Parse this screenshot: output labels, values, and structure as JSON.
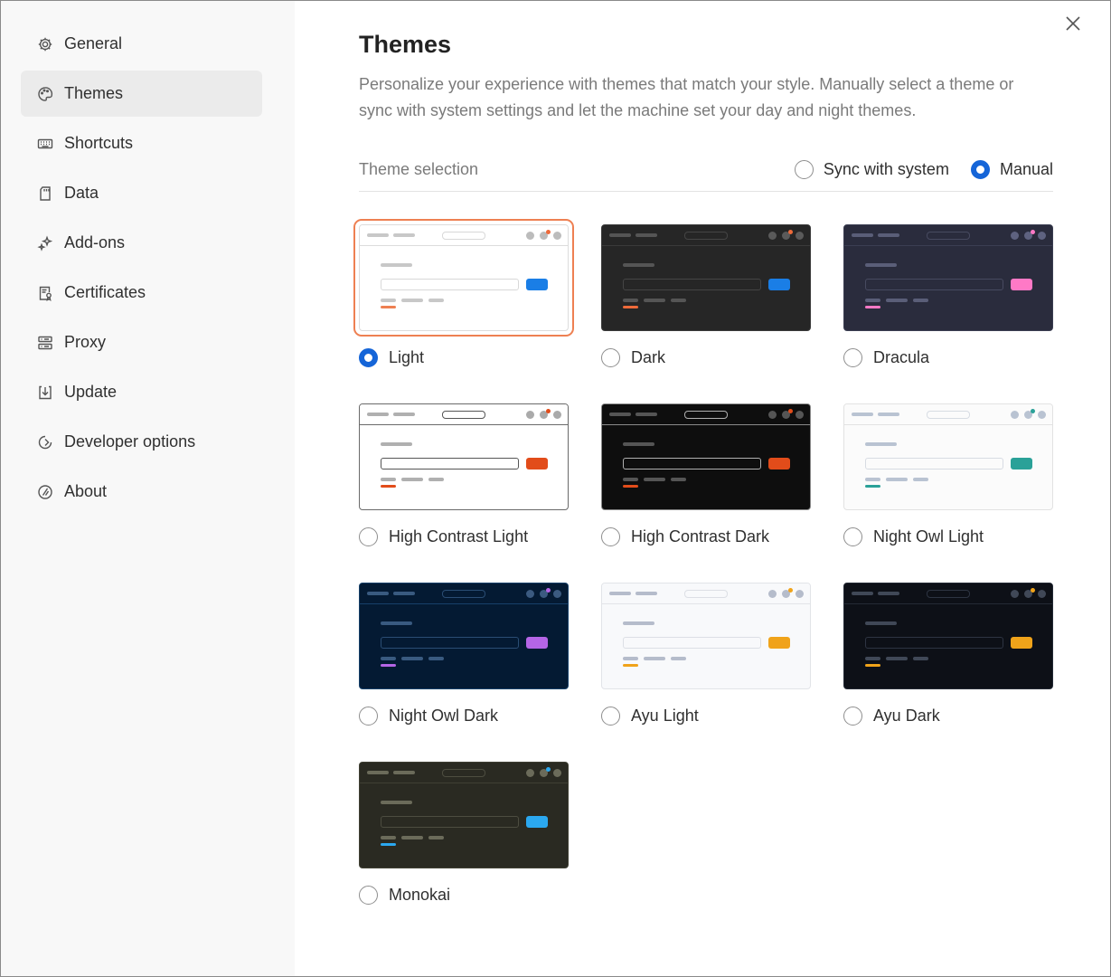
{
  "sidebar": {
    "items": [
      {
        "label": "General",
        "icon": "gear-icon",
        "active": false
      },
      {
        "label": "Themes",
        "icon": "palette-icon",
        "active": true
      },
      {
        "label": "Shortcuts",
        "icon": "keyboard-icon",
        "active": false
      },
      {
        "label": "Data",
        "icon": "sd-card-icon",
        "active": false
      },
      {
        "label": "Add-ons",
        "icon": "sparkles-icon",
        "active": false
      },
      {
        "label": "Certificates",
        "icon": "certificate-icon",
        "active": false
      },
      {
        "label": "Proxy",
        "icon": "server-icon",
        "active": false
      },
      {
        "label": "Update",
        "icon": "download-icon",
        "active": false
      },
      {
        "label": "Developer options",
        "icon": "developer-icon",
        "active": false
      },
      {
        "label": "About",
        "icon": "info-badge-icon",
        "active": false
      }
    ]
  },
  "header": {
    "title": "Themes",
    "description": "Personalize your experience with themes that match your style. Manually select a theme or sync with system settings and let the machine set your day and night themes."
  },
  "theme_selection": {
    "label": "Theme selection",
    "options": [
      {
        "label": "Sync with system",
        "checked": false
      },
      {
        "label": "Manual",
        "checked": true
      }
    ]
  },
  "themes": [
    {
      "label": "Light",
      "checked": true,
      "colors": {
        "bg": "#ffffff",
        "bar": "#ffffff",
        "border": "#dcdcdc",
        "line": "#c8c8c8",
        "inputBorder": "#d8d8d8",
        "btn": "#1a7ee6",
        "underline": "#ee8052",
        "dot": "#bcbcbc",
        "accent": "#ee6a3a"
      }
    },
    {
      "label": "Dark",
      "checked": false,
      "colors": {
        "bg": "#262626",
        "bar": "#262626",
        "border": "#3a3a3a",
        "line": "#555555",
        "inputBorder": "#454545",
        "btn": "#1a7ee6",
        "underline": "#ee6a3a",
        "dot": "#5a5a5a",
        "accent": "#ee6a3a"
      }
    },
    {
      "label": "Dracula",
      "checked": false,
      "colors": {
        "bg": "#2a2c3d",
        "bar": "#2a2c3d",
        "border": "#3b3e52",
        "line": "#5a5e78",
        "inputBorder": "#474a60",
        "btn": "#ff79c6",
        "underline": "#ff79c6",
        "dot": "#5e6280",
        "accent": "#ff79c6"
      }
    },
    {
      "label": "High Contrast Light",
      "checked": false,
      "colors": {
        "bg": "#ffffff",
        "bar": "#ffffff",
        "border": "#6a6a6a",
        "line": "#b0b0b0",
        "inputBorder": "#555555",
        "btn": "#e24c1a",
        "underline": "#e24c1a",
        "dot": "#aaaaaa",
        "accent": "#e24c1a"
      }
    },
    {
      "label": "High Contrast Dark",
      "checked": false,
      "colors": {
        "bg": "#0e0e0e",
        "bar": "#0e0e0e",
        "border": "#8a8a8a",
        "line": "#555555",
        "inputBorder": "#b0b0b0",
        "btn": "#e24c1a",
        "underline": "#e24c1a",
        "dot": "#555555",
        "accent": "#e24c1a"
      }
    },
    {
      "label": "Night Owl Light",
      "checked": false,
      "colors": {
        "bg": "#fbfbfb",
        "bar": "#fbfbfb",
        "border": "#e2e2e2",
        "line": "#b9c3d2",
        "inputBorder": "#d7dce3",
        "btn": "#2aa198",
        "underline": "#2aa198",
        "dot": "#b9c3d2",
        "accent": "#2aa198"
      }
    },
    {
      "label": "Night Owl Dark",
      "checked": false,
      "colors": {
        "bg": "#041a33",
        "bar": "#041a33",
        "border": "#16406a",
        "line": "#395a80",
        "inputBorder": "#2a4d74",
        "btn": "#b565e6",
        "underline": "#b565e6",
        "dot": "#3b5a80",
        "accent": "#b565e6"
      }
    },
    {
      "label": "Ayu Light",
      "checked": false,
      "colors": {
        "bg": "#f8f9fb",
        "bar": "#f8f9fb",
        "border": "#e2e4e8",
        "line": "#b5bccb",
        "inputBorder": "#dcdfe5",
        "btn": "#f0a31a",
        "underline": "#f0a31a",
        "dot": "#b5bccb",
        "accent": "#f0a31a"
      }
    },
    {
      "label": "Ayu Dark",
      "checked": false,
      "colors": {
        "bg": "#0d1017",
        "bar": "#0d1017",
        "border": "#242a35",
        "line": "#404857",
        "inputBorder": "#2d3442",
        "btn": "#f0a31a",
        "underline": "#f0a31a",
        "dot": "#404857",
        "accent": "#f0a31a"
      }
    },
    {
      "label": "Monokai",
      "checked": false,
      "colors": {
        "bg": "#2a2a22",
        "bar": "#2a2a22",
        "border": "#404034",
        "line": "#6b6b5a",
        "inputBorder": "#4d4d40",
        "btn": "#2ba8f0",
        "underline": "#2ba8f0",
        "dot": "#6b6b5a",
        "accent": "#2ba8f0"
      }
    }
  ],
  "colors": {
    "accent": "#1565d8",
    "selected_outline": "#ee8052"
  }
}
